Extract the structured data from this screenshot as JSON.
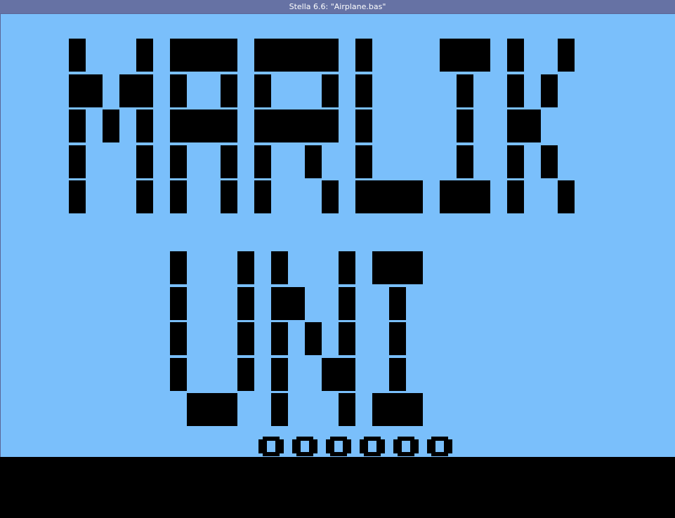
{
  "window": {
    "title": "Stella 6.6: \"Airplane.bas\""
  },
  "game": {
    "background_color": "#7abffb",
    "playfield_color": "#000000",
    "banner_text_line1": "MARLIK",
    "banner_text_line2": "UNI",
    "score": "000000"
  }
}
